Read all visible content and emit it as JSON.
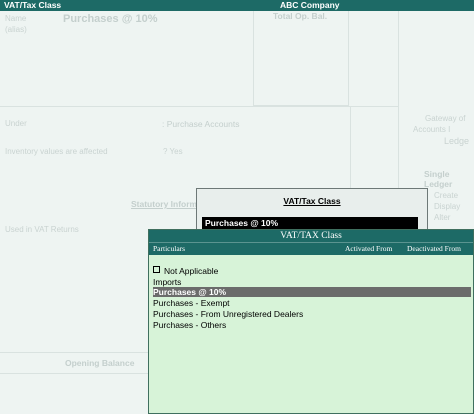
{
  "titlebar": {
    "left": "VAT/Tax Class",
    "company": "ABC Company"
  },
  "background": {
    "name_label": "Name",
    "alias_label": "(alias)",
    "name_value": "Purchases @ 10%",
    "total_op_bal": "Total Op. Bal.",
    "under_label": "Under",
    "under_value": ": Purchase Accounts",
    "inventory_label": "Inventory values are affected",
    "inventory_value": "? Yes",
    "statutory_info": "Statutory Information",
    "used_in_vat": "Used in VAT Returns",
    "opening_balance": "Opening Balance",
    "right_panel": {
      "gateway": "Gateway of",
      "accounts": "Accounts I",
      "ledger": "Ledge",
      "single_ledger": "Single Ledger",
      "create": "Create",
      "display": "Display",
      "alter": "Alter"
    }
  },
  "popup": {
    "title": "VAT/Tax Class",
    "value": "Purchases @ 10%"
  },
  "list": {
    "title": "VAT/TAX Class",
    "columns": {
      "particulars": "Particulars",
      "activated_from": "Activated From",
      "deactivated_from": "Deactivated From"
    },
    "items": [
      "Not Applicable",
      "Imports",
      "Purchases @ 10%",
      "Purchases - Exempt",
      "Purchases - From Unregistered Dealers",
      "Purchases - Others"
    ],
    "selected_index": 2
  },
  "colors": {
    "titlebar": "#1d6a66",
    "list_bg": "#d7f3d8",
    "selected_bg": "#6b6b6b"
  }
}
